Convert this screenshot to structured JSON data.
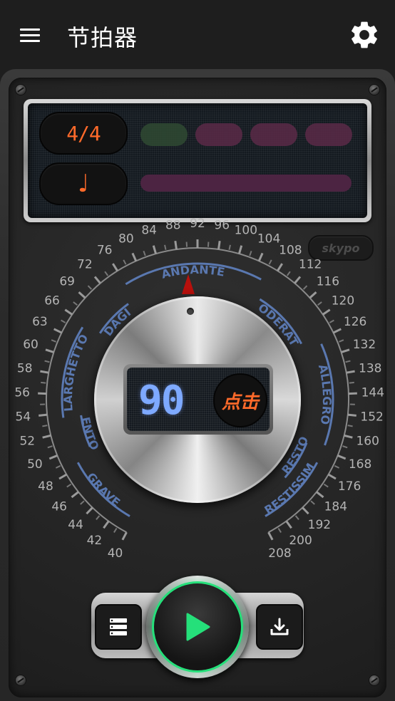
{
  "appbar": {
    "title": "节拍器"
  },
  "display": {
    "time_signature": "4/4",
    "note_symbol": "♩",
    "beats": 4
  },
  "badge": {
    "label": "skypo"
  },
  "dial": {
    "tick_values": [
      "40",
      "42",
      "44",
      "46",
      "48",
      "50",
      "52",
      "54",
      "56",
      "58",
      "60",
      "63",
      "66",
      "69",
      "72",
      "76",
      "80",
      "84",
      "88",
      "92",
      "96",
      "100",
      "104",
      "108",
      "112",
      "116",
      "120",
      "126",
      "132",
      "138",
      "144",
      "152",
      "160",
      "168",
      "176",
      "184",
      "192",
      "200",
      "208"
    ],
    "tempo_labels": [
      "GRAVE",
      "LENTO",
      "LARGHETTO",
      "ADAGIO",
      "ANDANTE",
      "MODERATO",
      "ALLEGRO",
      "PRESTO",
      "PRESTISSIMO"
    ]
  },
  "knob": {
    "bpm": "90",
    "tap_label": "点击"
  },
  "colors": {
    "accent": "#ff6a2a",
    "bpm": "#7ea9ff",
    "play": "#25e07a",
    "arc": "#5a78b0"
  }
}
